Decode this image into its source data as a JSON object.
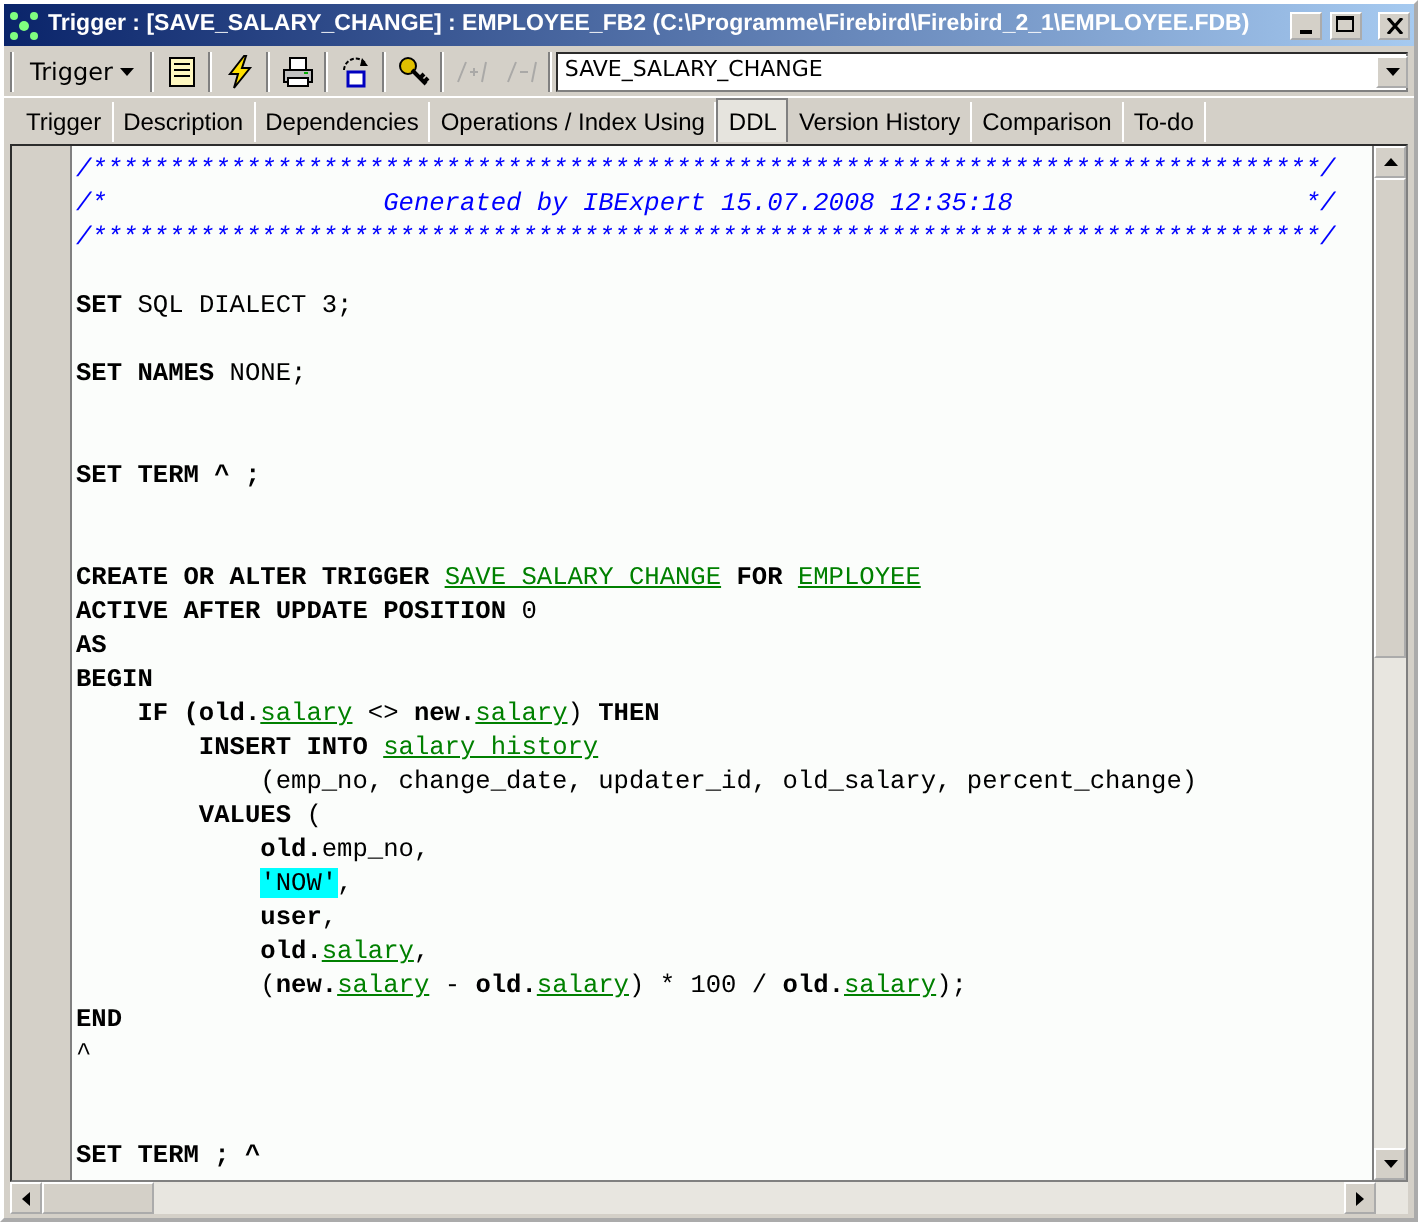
{
  "window": {
    "title": "Trigger : [SAVE_SALARY_CHANGE] : EMPLOYEE_FB2 (C:\\Programme\\Firebird\\Firebird_2_1\\EMPLOYEE.FDB)"
  },
  "toolbar": {
    "menu": "Trigger",
    "tools": [
      {
        "kind": "form",
        "disabled": false
      },
      {
        "kind": "lightning",
        "disabled": false
      },
      {
        "kind": "printer",
        "disabled": false
      },
      {
        "kind": "export",
        "disabled": false
      },
      {
        "kind": "keys",
        "disabled": false
      },
      {
        "kind": "comment",
        "disabled": true
      },
      {
        "kind": "uncomment",
        "disabled": true
      }
    ],
    "name_field": {
      "value": "SAVE_SALARY_CHANGE"
    }
  },
  "tabs": [
    {
      "label": "Trigger",
      "selected": false
    },
    {
      "label": "Description",
      "selected": false
    },
    {
      "label": "Dependencies",
      "selected": false
    },
    {
      "label": "Operations / Index Using",
      "selected": false
    },
    {
      "label": "DDL",
      "selected": true
    },
    {
      "label": "Version History",
      "selected": false
    },
    {
      "label": "Comparison",
      "selected": false
    },
    {
      "label": "To-do",
      "selected": false
    }
  ],
  "editor": {
    "blocks": [
      {
        "lines": [
          [
            {
              "kind": "comment",
              "text": "/********************************************************************************/"
            }
          ],
          [
            {
              "kind": "comment",
              "text": "/*                  Generated by IBExpert 15.07.2008 12:35:18                   */"
            }
          ],
          [
            {
              "kind": "comment",
              "text": "/********************************************************************************/"
            }
          ]
        ]
      },
      {
        "lines": [
          [
            {
              "kind": "keyword",
              "text": "SET"
            },
            {
              "kind": "plain",
              "text": " SQL DIALECT 3;"
            }
          ]
        ]
      },
      {
        "lines": [
          [
            {
              "kind": "keyword",
              "text": "SET NAMES"
            },
            {
              "kind": "plain",
              "text": " NONE;"
            }
          ]
        ]
      },
      {
        "lines": [
          [
            {
              "kind": "keyword",
              "text": "SET TERM ^ ;"
            }
          ]
        ]
      },
      {
        "lines": [
          [
            {
              "kind": "keyword",
              "text": "CREATE OR ALTER TRIGGER "
            },
            {
              "kind": "identifier",
              "text": "SAVE SALARY CHANGE"
            },
            {
              "kind": "keyword",
              "text": " FOR "
            },
            {
              "kind": "identifier",
              "text": "EMPLOYEE"
            }
          ],
          [
            {
              "kind": "keyword",
              "text": "ACTIVE AFTER UPDATE POSITION"
            },
            {
              "kind": "plain",
              "text": " 0"
            }
          ],
          [
            {
              "kind": "keyword",
              "text": "AS"
            }
          ],
          [
            {
              "kind": "keyword",
              "text": "BEGIN"
            }
          ],
          [
            {
              "kind": "keyword",
              "text": "    IF (old."
            },
            {
              "kind": "identifier",
              "text": "salary"
            },
            {
              "kind": "plain",
              "text": " <> "
            },
            {
              "kind": "keyword",
              "text": "new."
            },
            {
              "kind": "identifier",
              "text": "salary"
            },
            {
              "kind": "plain",
              "text": ")"
            },
            {
              "kind": "keyword",
              "text": " THEN"
            }
          ],
          [
            {
              "kind": "keyword",
              "text": "        INSERT INTO "
            },
            {
              "kind": "identifier",
              "text": "salary history"
            }
          ],
          [
            {
              "kind": "plain",
              "text": "            (emp_no, change_date, updater_id, old_salary, percent_change)"
            }
          ],
          [
            {
              "kind": "keyword",
              "text": "        VALUES"
            },
            {
              "kind": "plain",
              "text": " ("
            }
          ],
          [
            {
              "kind": "keyword",
              "text": "            old."
            },
            {
              "kind": "plain",
              "text": "emp_no,"
            }
          ],
          [
            {
              "kind": "string",
              "text": "            'NOW'"
            },
            {
              "kind": "plain",
              "text": ","
            }
          ],
          [
            {
              "kind": "keyword",
              "text": "            user"
            },
            {
              "kind": "plain",
              "text": ","
            }
          ],
          [
            {
              "kind": "keyword",
              "text": "            old."
            },
            {
              "kind": "identifier",
              "text": "salary"
            },
            {
              "kind": "plain",
              "text": ","
            }
          ],
          [
            {
              "kind": "plain",
              "text": "            ("
            },
            {
              "kind": "keyword",
              "text": "new."
            },
            {
              "kind": "identifier",
              "text": "salary"
            },
            {
              "kind": "plain",
              "text": " - "
            },
            {
              "kind": "keyword",
              "text": "old."
            },
            {
              "kind": "identifier",
              "text": "salary"
            },
            {
              "kind": "plain",
              "text": ") * 100 / "
            },
            {
              "kind": "keyword",
              "text": "old."
            },
            {
              "kind": "identifier",
              "text": "salary"
            },
            {
              "kind": "plain",
              "text": ");"
            }
          ],
          [
            {
              "kind": "keyword",
              "text": "END"
            }
          ],
          [
            {
              "kind": "plain",
              "text": "^"
            }
          ]
        ]
      },
      {
        "lines": [
          [
            {
              "kind": "keyword",
              "text": "SET TERM ; ^"
            }
          ]
        ]
      }
    ]
  }
}
